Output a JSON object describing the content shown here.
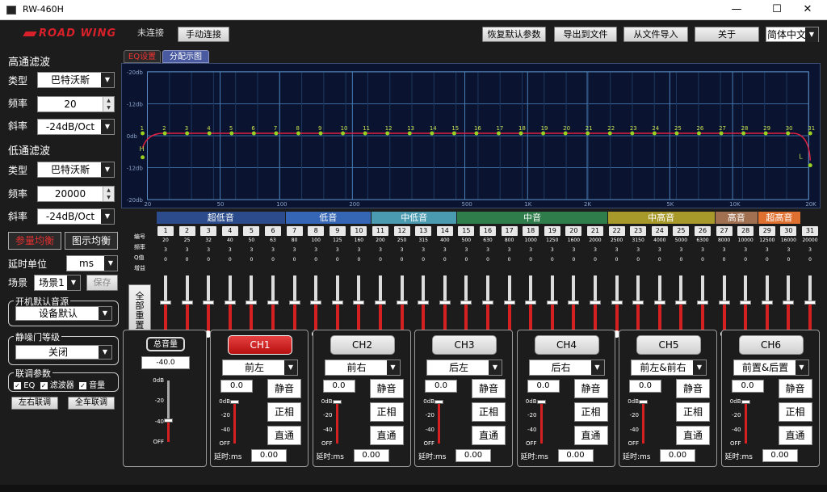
{
  "window": {
    "title": "RW-460H",
    "minimize": "—",
    "maximize": "☐",
    "close": "✕"
  },
  "brand": {
    "logo": "ROAD WING",
    "color": "#d8202a"
  },
  "status": "未连接",
  "toolbar": {
    "connect": "手动连接",
    "restore": "恢复默认参数",
    "export": "导出到文件",
    "import": "从文件导入",
    "about": "关于",
    "language": "简体中文"
  },
  "highpass": {
    "title": "高通滤波",
    "type_label": "类型",
    "type": "巴特沃斯",
    "freq_label": "频率",
    "freq": "20",
    "slope_label": "斜率",
    "slope": "-24dB/Oct"
  },
  "lowpass": {
    "title": "低通滤波",
    "type_label": "类型",
    "type": "巴特沃斯",
    "freq_label": "频率",
    "freq": "20000",
    "slope_label": "斜率",
    "slope": "-24dB/Oct"
  },
  "eq_buttons": {
    "param": "参量均衡",
    "graphic": "图示均衡"
  },
  "delay_unit": {
    "label": "延时单位",
    "value": "ms"
  },
  "scene": {
    "label": "场景",
    "value": "场景1",
    "save": "保存"
  },
  "boot_source": {
    "title": "开机默认音源",
    "value": "设备默认"
  },
  "mute_level": {
    "title": "静噪门等级",
    "value": "关闭"
  },
  "link": {
    "title": "联调参数",
    "eq": "EQ",
    "filter": "滤波器",
    "volume": "音量",
    "lr": "左右联调",
    "all": "全车联调"
  },
  "tabs": {
    "eq": "EQ设置",
    "split": "分配示图"
  },
  "graph": {
    "y_labels": [
      "-20db",
      "-12db",
      "0db",
      "-12db",
      "-20db"
    ],
    "x_labels": [
      "20",
      "50",
      "100",
      "200",
      "500",
      "1K",
      "2K",
      "5K",
      "10K",
      "20K"
    ],
    "h_marker": "H",
    "l_marker": "L",
    "points": [
      "1",
      "2",
      "3",
      "4",
      "5",
      "6",
      "7",
      "8",
      "9",
      "10",
      "11",
      "12",
      "13",
      "14",
      "15",
      "16",
      "17",
      "18",
      "19",
      "20",
      "21",
      "22",
      "23",
      "24",
      "25",
      "26",
      "27",
      "28",
      "29",
      "30",
      "31"
    ]
  },
  "bands": [
    {
      "name": "超低音",
      "color": "#2b4b8c"
    },
    {
      "name": "低音",
      "color": "#3565b5"
    },
    {
      "name": "中低音",
      "color": "#4a9ab0"
    },
    {
      "name": "中音",
      "color": "#2e7d4a"
    },
    {
      "name": "中高音",
      "color": "#a89a2a"
    },
    {
      "name": "高音",
      "color": "#a07050"
    },
    {
      "name": "超高音",
      "color": "#e07030"
    }
  ],
  "row_labels": {
    "num": "编号",
    "freq": "频率",
    "q": "Q值",
    "gain": "增益"
  },
  "reset_all": "全部重置",
  "eq_freqs": [
    "20",
    "25",
    "32",
    "40",
    "50",
    "63",
    "80",
    "100",
    "125",
    "160",
    "200",
    "250",
    "315",
    "400",
    "500",
    "630",
    "800",
    "1000",
    "1250",
    "1600",
    "2000",
    "2500",
    "3150",
    "4000",
    "5000",
    "6300",
    "8000",
    "10000",
    "12500",
    "16000",
    "20000"
  ],
  "eq_q": "3",
  "eq_gain": "0",
  "master": {
    "label": "总音量",
    "value": "-40.0",
    "ticks": [
      "0dB",
      "-20",
      "-40",
      "OFF"
    ],
    "level": 0.35
  },
  "channels": [
    {
      "name": "CH1",
      "pos": "前左",
      "active": true
    },
    {
      "name": "CH2",
      "pos": "前右",
      "active": false
    },
    {
      "name": "CH3",
      "pos": "后左",
      "active": false
    },
    {
      "name": "CH4",
      "pos": "后右",
      "active": false
    },
    {
      "name": "CH5",
      "pos": "前左&前右",
      "active": false
    },
    {
      "name": "CH6",
      "pos": "前置&后置",
      "active": false
    }
  ],
  "ch_common": {
    "gain": "0.0",
    "mute": "静音",
    "phase": "正相",
    "bypass": "直通",
    "delay_label": "延时:ms",
    "delay": "0.00",
    "ticks": [
      "0dB",
      "-20",
      "-40",
      "OFF"
    ],
    "level": 1.0
  }
}
